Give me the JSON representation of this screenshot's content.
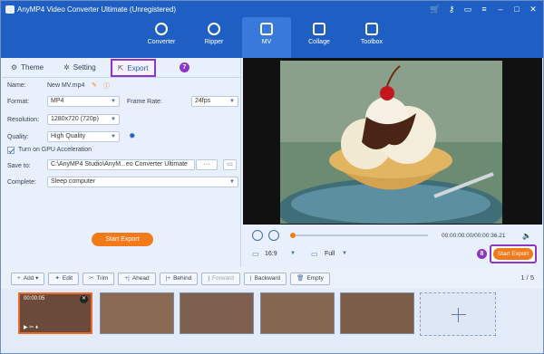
{
  "window": {
    "title": "AnyMP4 Video Converter Ultimate (Unregistered)"
  },
  "nav": {
    "items": [
      "Converter",
      "Ripper",
      "MV",
      "Collage",
      "Toolbox"
    ],
    "active": "MV"
  },
  "left_tabs": {
    "theme": "Theme",
    "setting": "Setting",
    "export": "Export"
  },
  "callouts": {
    "export_tab": "7",
    "start_export": "8"
  },
  "export_settings": {
    "name_label": "Name:",
    "name_value": "New MV.mp4",
    "format_label": "Format:",
    "format_value": "MP4",
    "framerate_label": "Frame Rate:",
    "framerate_value": "24fps",
    "resolution_label": "Resolution:",
    "resolution_value": "1280x720 (720p)",
    "quality_label": "Quality:",
    "quality_value": "High Quality",
    "gpu_label": "Turn on GPU Acceleration",
    "gpu_checked": true,
    "saveto_label": "Save to:",
    "saveto_value": "C:\\AnyMP4 Studio\\AnyM...eo Converter Ultimate",
    "browse_label": "···",
    "complete_label": "Complete:",
    "complete_value": "Sleep computer",
    "start_export_label": "Start Export"
  },
  "player": {
    "time": "00:00:00.00/00:00:36.21",
    "aspect": "16:9",
    "view": "Full",
    "start_export_label": "Start Export"
  },
  "toolbar": {
    "add": "Add",
    "edit": "Edit",
    "trim": "Trim",
    "ahead": "Ahead",
    "behind": "Behind",
    "forward": "Forward",
    "backward": "Backward",
    "empty": "Empty",
    "page": "1",
    "page_total": "5"
  },
  "timeline": {
    "first_clip_time": "00:00:05"
  },
  "colors": {
    "brand_blue": "#1f5fc4",
    "accent_orange": "#f27a1a",
    "highlight_purple": "#8b35c9"
  }
}
